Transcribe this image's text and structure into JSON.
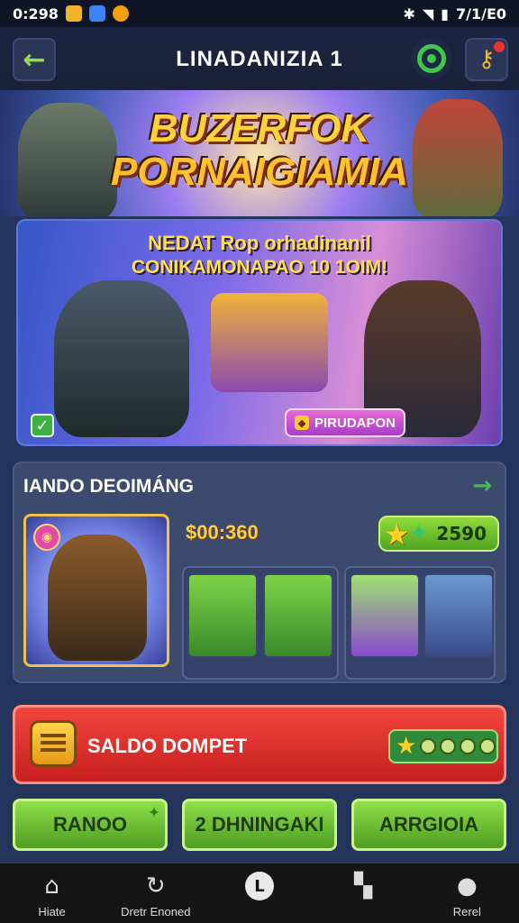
{
  "status_bar": {
    "time": "0:298",
    "right_text": "7/1/E0"
  },
  "header": {
    "title": "LINADANIZIA 1"
  },
  "banner": {
    "title_line1": "BUZERFOK",
    "title_line2": "PORNAIGIAMIA"
  },
  "promo": {
    "line1": "NEDAT Rop orhadinanil",
    "line2": "CONIKAMONAPAO 10 1OIM!",
    "button_label": "PIRUDAPON"
  },
  "loading_panel": {
    "title": "IANDO DEOIMÁNG",
    "price": "$00:360",
    "score": "2590"
  },
  "wallet": {
    "label": "SALDO DOMPET"
  },
  "actions": [
    {
      "label": "RANOO"
    },
    {
      "label": "2 DHNINGAKI"
    },
    {
      "label": "ARRGIOIA"
    }
  ],
  "nav": {
    "items": [
      {
        "label": "Hiate"
      },
      {
        "label": "Dretr Enoned"
      },
      {
        "label": ""
      },
      {
        "label": ""
      },
      {
        "label": "Rerel"
      }
    ]
  },
  "colors": {
    "accent_green": "#4f9d22",
    "wallet_red": "#c71f1f",
    "gold": "#ffce3a"
  }
}
